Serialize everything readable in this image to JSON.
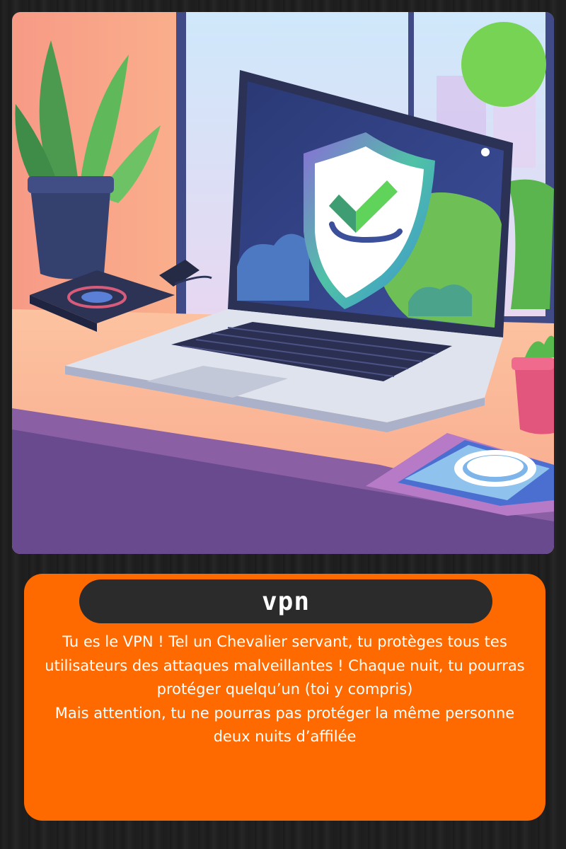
{
  "card": {
    "role_name": "vpn",
    "description": "Tu es le VPN ! Tel un Chevalier servant, tu protèges tous tes utilisateurs des attaques malveillantes ! Chaque nuit, tu pourras protéger quelqu’un (toi y compris)\nMais attention, tu ne pourras pas protéger la même personne deux nuits d’affilée"
  },
  "colors": {
    "panel": "#ff6a00",
    "title_pill": "#2b2b2b",
    "status_dot": "#77d353",
    "shield_check": "#5fd35a"
  },
  "illustration": {
    "subject": "laptop-with-vpn-shield",
    "icons": [
      "shield-check-icon",
      "plant-pot-icon",
      "notebook-icon",
      "smartphone-icon",
      "succulent-pot-icon",
      "tablet-icon"
    ]
  }
}
